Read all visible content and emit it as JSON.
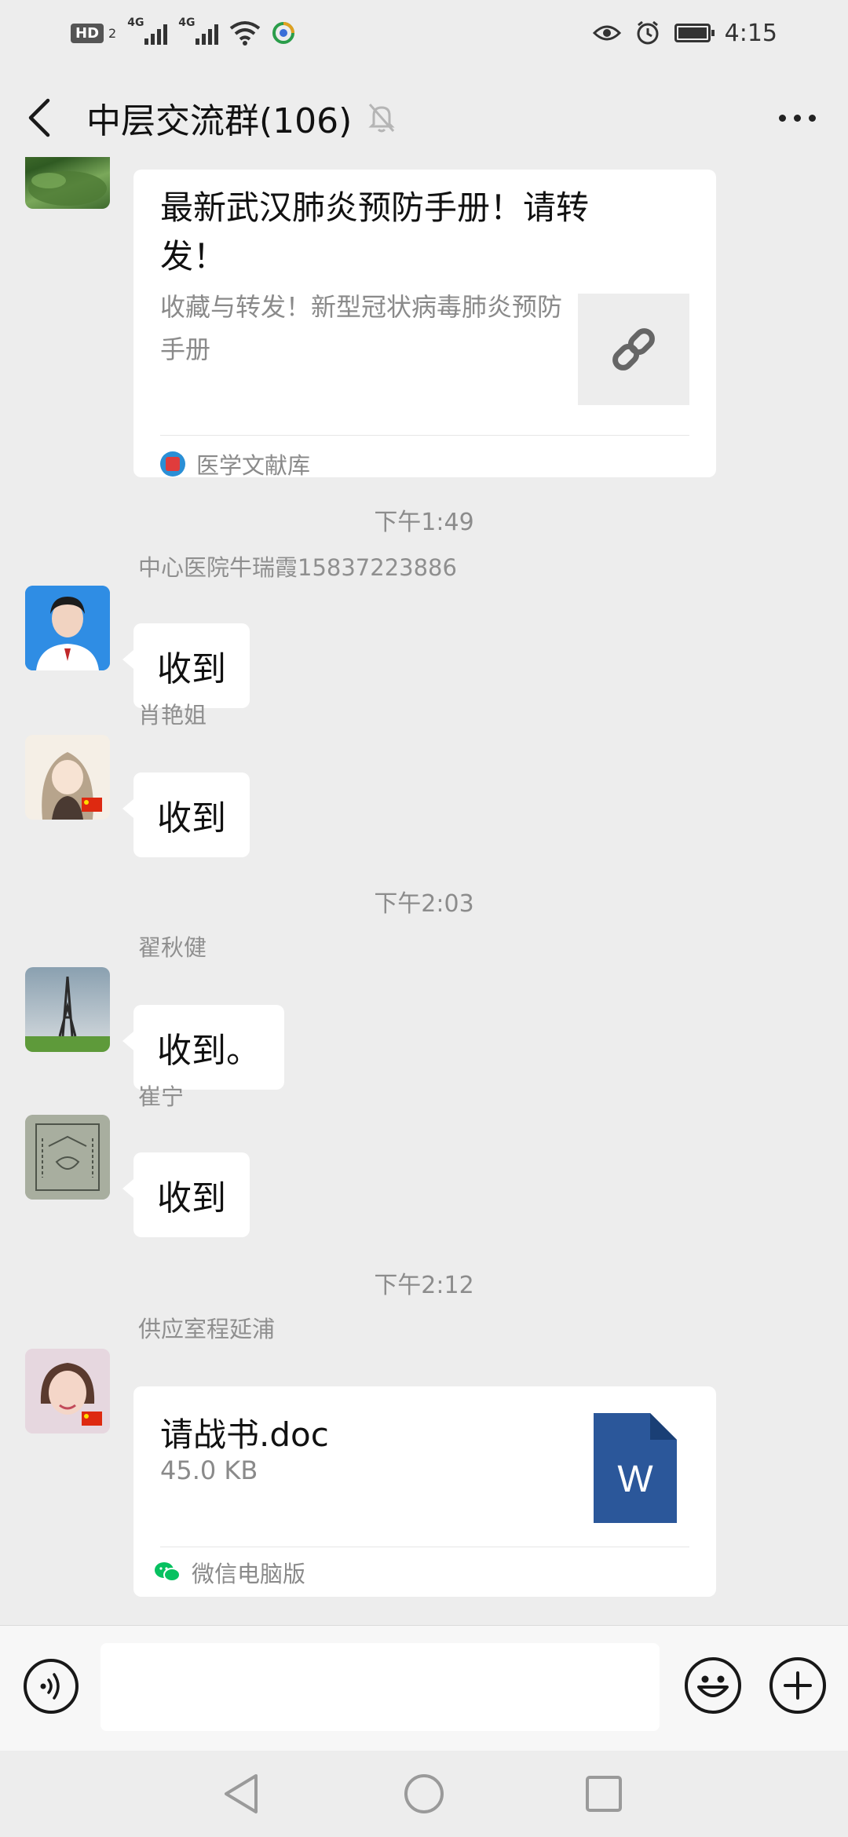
{
  "status_bar": {
    "hd_badge": "HD",
    "hd_sub": "2",
    "net1": "4G",
    "net2": "4G",
    "time": "4:15"
  },
  "header": {
    "title": "中层交流群(106)",
    "icons": [
      "back-icon",
      "mute-bell-icon",
      "more-icon"
    ]
  },
  "messages": {
    "link_card": {
      "title": "最新武汉肺炎预防手册！请转发！",
      "description": "收藏与转发！新型冠状病毒肺炎预防手册",
      "source": "医学文献库"
    },
    "time1": "下午1:49",
    "msg1": {
      "sender": "中心医院牛瑞霞15837223886",
      "text": "收到"
    },
    "msg2": {
      "sender": "肖艳姐",
      "text": "收到"
    },
    "time2": "下午2:03",
    "msg3": {
      "sender": "翟秋健",
      "text": "收到。"
    },
    "msg4": {
      "sender": "崔宁",
      "text": "收到"
    },
    "time3": "下午2:12",
    "file_msg": {
      "sender": "供应室程延浦",
      "file_name": "请战书.doc",
      "file_size": "45.0 KB",
      "file_type_letter": "W",
      "source": "微信电脑版"
    }
  },
  "input_bar": {
    "placeholder": "",
    "icons": [
      "voice-icon",
      "emoji-icon",
      "plus-icon"
    ]
  },
  "nav_bar": {
    "icons": [
      "nav-back-icon",
      "nav-home-icon",
      "nav-recents-icon"
    ]
  },
  "colors": {
    "background": "#ededed",
    "bubble": "#ffffff",
    "word_blue": "#2b579a",
    "wechat_green": "#07c160"
  }
}
